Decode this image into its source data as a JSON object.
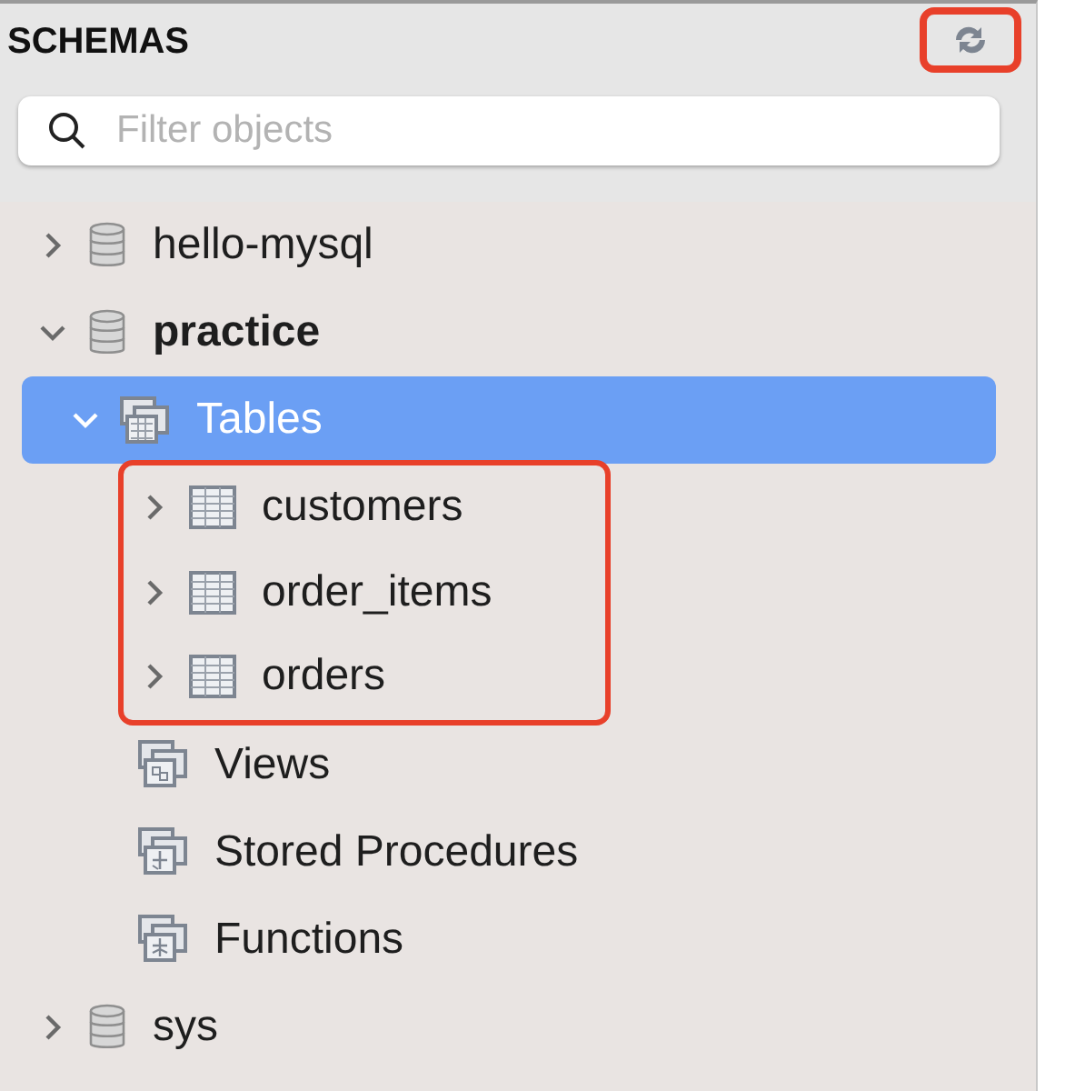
{
  "header": {
    "title": "SCHEMAS",
    "refresh": {
      "highlighted": true
    }
  },
  "search": {
    "placeholder": "Filter objects"
  },
  "tree": [
    {
      "label": "hello-mysql",
      "kind": "schema",
      "expanded": false,
      "default": false,
      "selected": false
    },
    {
      "label": "practice",
      "kind": "schema",
      "expanded": true,
      "default": true,
      "selected": false,
      "children": [
        {
          "label": "Tables",
          "kind": "folder",
          "expanded": true,
          "selected": true,
          "children_highlighted": true,
          "children": [
            {
              "label": "customers",
              "kind": "table",
              "expanded": false,
              "selected": false
            },
            {
              "label": "order_items",
              "kind": "table",
              "expanded": false,
              "selected": false
            },
            {
              "label": "orders",
              "kind": "table",
              "expanded": false,
              "selected": false
            }
          ]
        },
        {
          "label": "Views",
          "kind": "views",
          "selected": false
        },
        {
          "label": "Stored Procedures",
          "kind": "procedures",
          "selected": false
        },
        {
          "label": "Functions",
          "kind": "functions",
          "selected": false
        }
      ]
    },
    {
      "label": "sys",
      "kind": "schema",
      "expanded": false,
      "default": false,
      "selected": false
    }
  ]
}
